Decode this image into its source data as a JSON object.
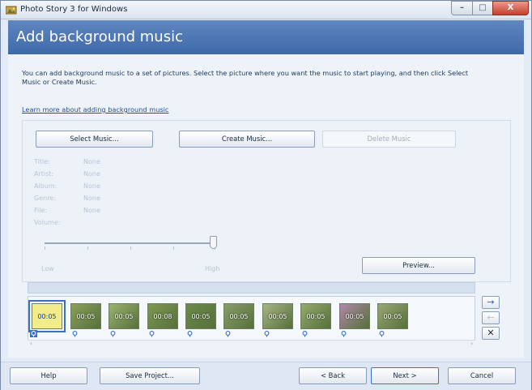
{
  "window": {
    "title": "Photo Story 3 for Windows",
    "controls": {
      "minimize": "–",
      "maximize": "□",
      "close": "X"
    }
  },
  "page": {
    "title": "Add background music",
    "intro": "You can add background music to a set of pictures.  Select the picture where you want the music to start playing, and then click Select Music or Create Music.",
    "learn_link": "Learn more about adding background music"
  },
  "music_buttons": {
    "select": "Select Music...",
    "create": "Create Music...",
    "delete": "Delete Music"
  },
  "music_info": [
    {
      "label": "Title:",
      "value": "None"
    },
    {
      "label": "Artist:",
      "value": "None"
    },
    {
      "label": "Album:",
      "value": "None"
    },
    {
      "label": "Genre:",
      "value": "None"
    },
    {
      "label": "File:",
      "value": "None"
    },
    {
      "label": "Volume:",
      "value": ""
    }
  ],
  "volume": {
    "low_label": "Low",
    "high_label": "High",
    "level": 1.0
  },
  "preview_label": "Preview...",
  "filmstrip": {
    "selected_index": 0,
    "thumbnails": [
      {
        "duration": "00:05",
        "color": "#f2ec8a"
      },
      {
        "duration": "00:05",
        "color": "#8aa05a"
      },
      {
        "duration": "00:05",
        "color": "#9cb36e"
      },
      {
        "duration": "00:08",
        "color": "#7f9a52"
      },
      {
        "duration": "00:05",
        "color": "#6c8a4a"
      },
      {
        "duration": "00:05",
        "color": "#8a9e6a"
      },
      {
        "duration": "00:05",
        "color": "#a7b584"
      },
      {
        "duration": "00:05",
        "color": "#93ab6c"
      },
      {
        "duration": "00:05",
        "color": "#b088a8"
      },
      {
        "duration": "00:05",
        "color": "#9aa874"
      }
    ],
    "scroll_left": "‹",
    "scroll_right": "›"
  },
  "side_buttons": {
    "move_right": "→",
    "move_left": "←",
    "remove": "✕"
  },
  "footer": {
    "help": "Help",
    "save_project": "Save Project...",
    "back": "< Back",
    "next": "Next >",
    "cancel": "Cancel"
  },
  "colors": {
    "accent": "#3f69a9",
    "selection": "#3a6fc4"
  }
}
